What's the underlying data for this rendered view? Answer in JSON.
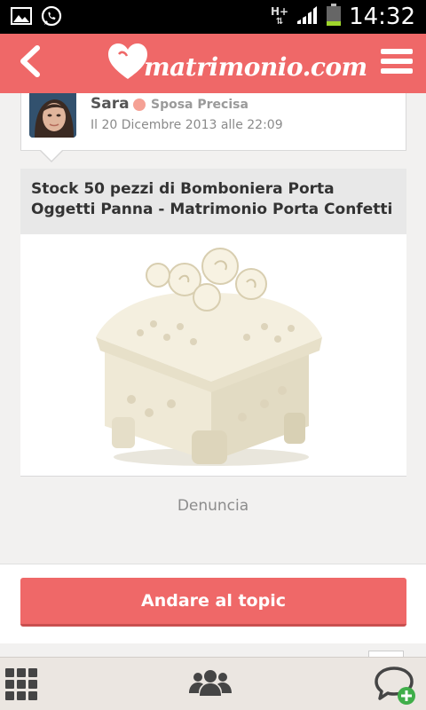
{
  "status_bar": {
    "time": "14:32",
    "network": "H+",
    "icons": [
      "gallery-icon",
      "whatsapp-icon",
      "signal-icon",
      "battery-icon"
    ]
  },
  "app_bar": {
    "logo_text": "matrimonio.com",
    "back_icon": "chevron-left-icon",
    "menu_icon": "hamburger-menu-icon",
    "color": "#ef6868"
  },
  "author": {
    "name": "Sara",
    "role": "Sposa Precisa",
    "date": "Il 20 Dicembre 2013 alle 22:09",
    "badge_color": "#f5a195"
  },
  "post": {
    "title": "Stock 50 pezzi di Bomboniera Porta Oggetti Panna - Matrimonio Porta Confetti"
  },
  "report_label": "Denuncia",
  "cta_label": "Andare al topic",
  "bottom_bar": {
    "items": [
      "grid-menu-icon",
      "community-users-icon",
      "new-chat-icon"
    ]
  }
}
